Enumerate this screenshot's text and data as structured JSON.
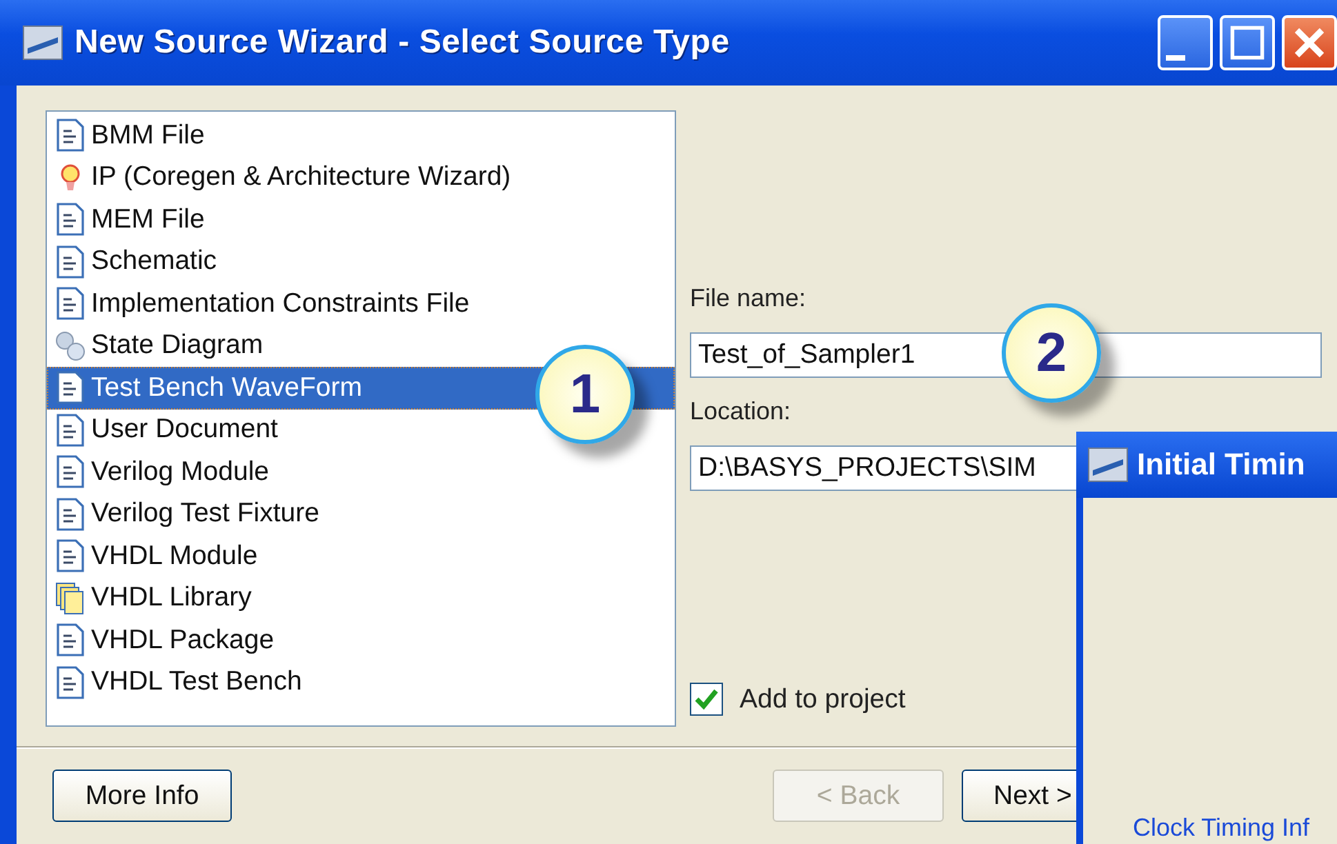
{
  "window": {
    "title": "New Source Wizard - Select Source Type"
  },
  "source_types": [
    {
      "label": "BMM File",
      "kind": "doc",
      "selected": false
    },
    {
      "label": "IP (Coregen & Architecture Wizard)",
      "kind": "bulb",
      "selected": false
    },
    {
      "label": "MEM File",
      "kind": "doc",
      "selected": false
    },
    {
      "label": "Schematic",
      "kind": "doc",
      "selected": false
    },
    {
      "label": "Implementation Constraints File",
      "kind": "doc",
      "selected": false
    },
    {
      "label": "State Diagram",
      "kind": "bubbles",
      "selected": false
    },
    {
      "label": "Test Bench WaveForm",
      "kind": "doc",
      "selected": true
    },
    {
      "label": "User Document",
      "kind": "doc",
      "selected": false
    },
    {
      "label": "Verilog Module",
      "kind": "doc",
      "selected": false
    },
    {
      "label": "Verilog Test Fixture",
      "kind": "doc",
      "selected": false
    },
    {
      "label": "VHDL Module",
      "kind": "doc",
      "selected": false
    },
    {
      "label": "VHDL Library",
      "kind": "stack",
      "selected": false
    },
    {
      "label": "VHDL Package",
      "kind": "doc",
      "selected": false
    },
    {
      "label": "VHDL Test Bench",
      "kind": "doc",
      "selected": false
    }
  ],
  "file_name": {
    "label": "File name:",
    "value": "Test_of_Sampler1"
  },
  "location": {
    "label": "Location:",
    "value": "D:\\BASYS_PROJECTS\\SIM"
  },
  "add_to_project": {
    "label": "Add to project",
    "checked": true
  },
  "callouts": [
    "1",
    "2"
  ],
  "buttons": [
    {
      "label": "More Info",
      "disabled": false
    },
    {
      "label": "< Back",
      "disabled": true
    },
    {
      "label": "Next >",
      "disabled": false
    }
  ],
  "second_window": {
    "title": "Initial Timin",
    "link": "Clock Timing Inf"
  }
}
